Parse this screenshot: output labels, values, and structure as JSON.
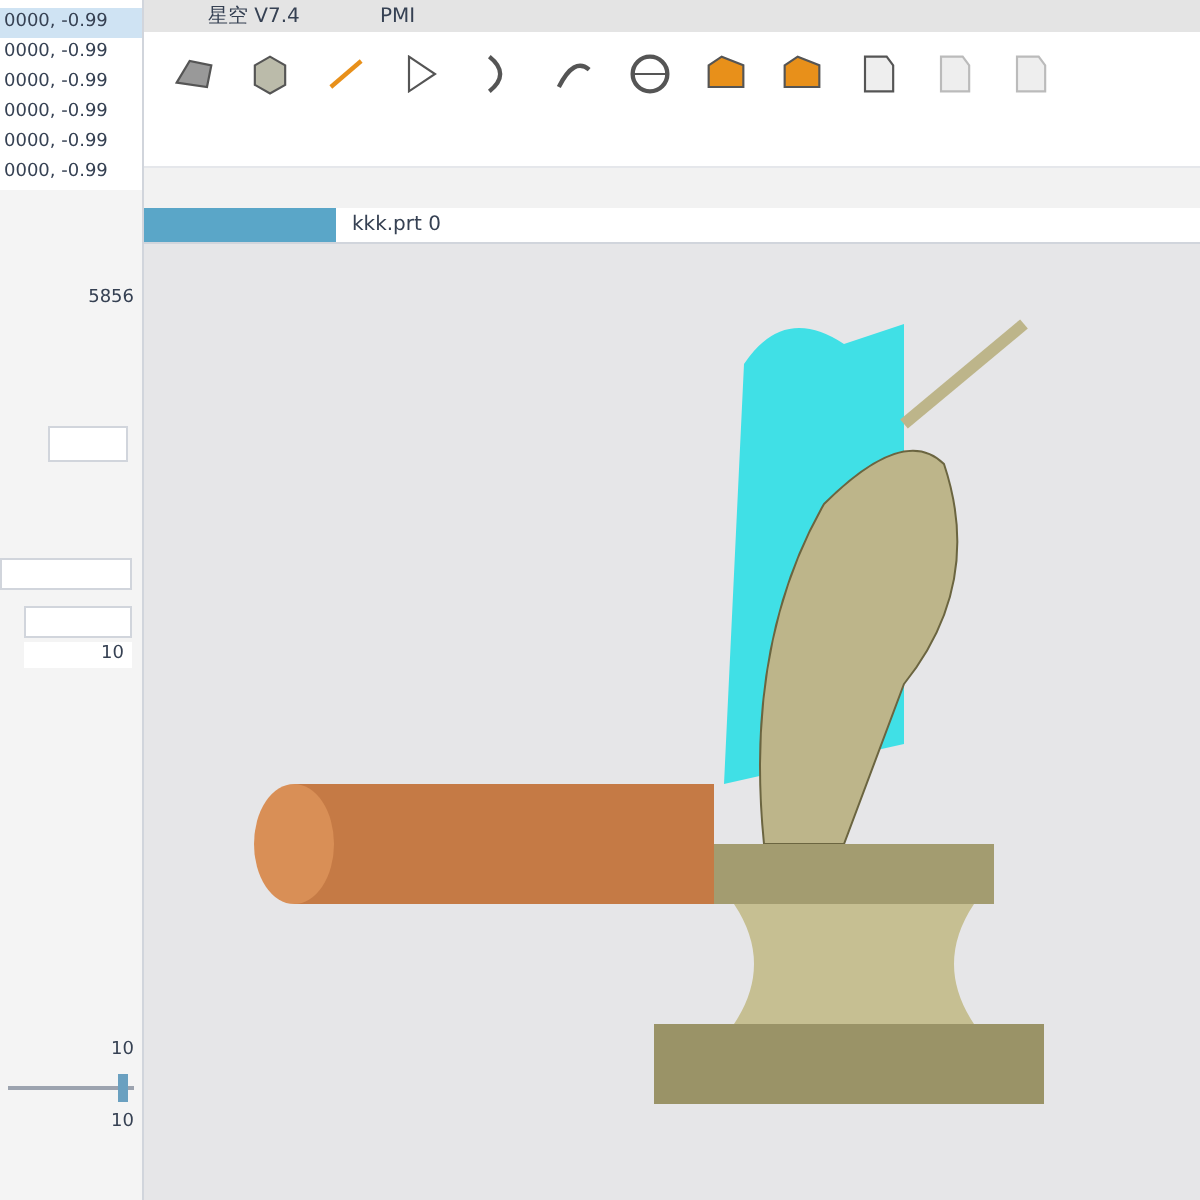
{
  "menu": [
    "星空 V7.4",
    "PMI"
  ],
  "coord_list": {
    "items": [
      {
        "text": "0000, -0.99",
        "selected": true
      },
      {
        "text": "0000, -0.99",
        "selected": false
      },
      {
        "text": "0000, -0.99",
        "selected": false
      },
      {
        "text": "0000, -0.99",
        "selected": false
      },
      {
        "text": "0000, -0.99",
        "selected": false
      },
      {
        "text": "0000, -0.99",
        "selected": false
      }
    ]
  },
  "tools": [
    {
      "kind": "shape",
      "enabled": true
    },
    {
      "kind": "cube",
      "enabled": true
    },
    {
      "kind": "line",
      "enabled": true
    },
    {
      "kind": "triangle",
      "enabled": true
    },
    {
      "kind": "arc",
      "enabled": true
    },
    {
      "kind": "curve",
      "enabled": true
    },
    {
      "kind": "circle",
      "enabled": true
    },
    {
      "kind": "folder",
      "enabled": true
    },
    {
      "kind": "folder",
      "enabled": true
    },
    {
      "kind": "sheet",
      "enabled": true
    },
    {
      "kind": "sheet",
      "enabled": false
    },
    {
      "kind": "sheet",
      "enabled": false
    }
  ],
  "tabs": [
    {
      "label": "kkk.prt 0",
      "selected": false
    }
  ],
  "panel": {
    "value": "5856",
    "field_value": "10",
    "slider": {
      "max": "10",
      "min": "10",
      "level": 0.95
    }
  }
}
